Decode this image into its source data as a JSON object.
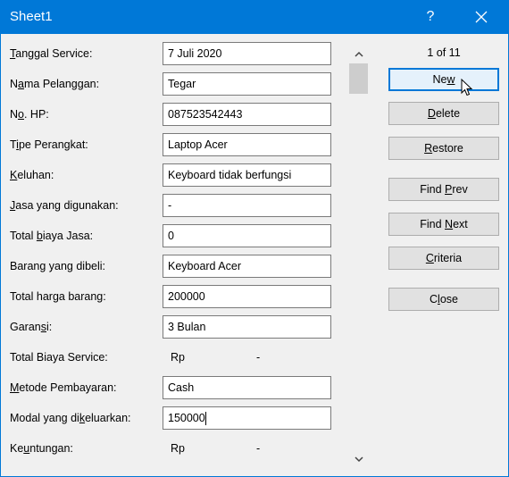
{
  "window": {
    "title": "Sheet1",
    "help_glyph": "?"
  },
  "fields": [
    {
      "pre": "",
      "key": "T",
      "post": "anggal Service:",
      "value": "7 Juli 2020"
    },
    {
      "pre": "N",
      "key": "a",
      "post": "ma Pelanggan:",
      "value": "Tegar"
    },
    {
      "pre": "N",
      "key": "o",
      "post": ". HP:",
      "value": "087523542443"
    },
    {
      "pre": "T",
      "key": "i",
      "post": "pe Perangkat:",
      "value": "Laptop Acer"
    },
    {
      "pre": "",
      "key": "K",
      "post": "eluhan:",
      "value": "Keyboard tidak berfungsi"
    },
    {
      "pre": "",
      "key": "J",
      "post": "asa yang digunakan:",
      "value": "-"
    },
    {
      "pre": "Total ",
      "key": "b",
      "post": "iaya Jasa:",
      "value": "0"
    },
    {
      "pre": "Barang yang dibeli",
      "key": "",
      "post": ":",
      "value": "Keyboard Acer"
    },
    {
      "pre": "Total harga baran",
      "key": "g",
      "post": ":",
      "value": "200000"
    },
    {
      "pre": "Garan",
      "key": "s",
      "post": "i:",
      "value": "3 Bulan"
    },
    {
      "pre": "Total Biaya Service:",
      "key": "",
      "post": "",
      "currency": "Rp",
      "value": "-"
    },
    {
      "pre": "",
      "key": "M",
      "post": "etode Pembayaran:",
      "value": "Cash"
    },
    {
      "pre": "Modal yang di",
      "key": "k",
      "post": "eluarkan:",
      "value": "150000"
    },
    {
      "pre": "Ke",
      "key": "u",
      "post": "ntungan:",
      "currency": "Rp",
      "value": "-"
    }
  ],
  "record_indicator": "1 of 11",
  "buttons": [
    {
      "pre": "Ne",
      "key": "w",
      "post": ""
    },
    {
      "pre": "",
      "key": "D",
      "post": "elete"
    },
    {
      "pre": "",
      "key": "R",
      "post": "estore"
    },
    {
      "pre": "Find ",
      "key": "P",
      "post": "rev"
    },
    {
      "pre": "Find ",
      "key": "N",
      "post": "ext"
    },
    {
      "pre": "",
      "key": "C",
      "post": "riteria"
    },
    {
      "pre": "C",
      "key": "l",
      "post": "ose"
    }
  ]
}
